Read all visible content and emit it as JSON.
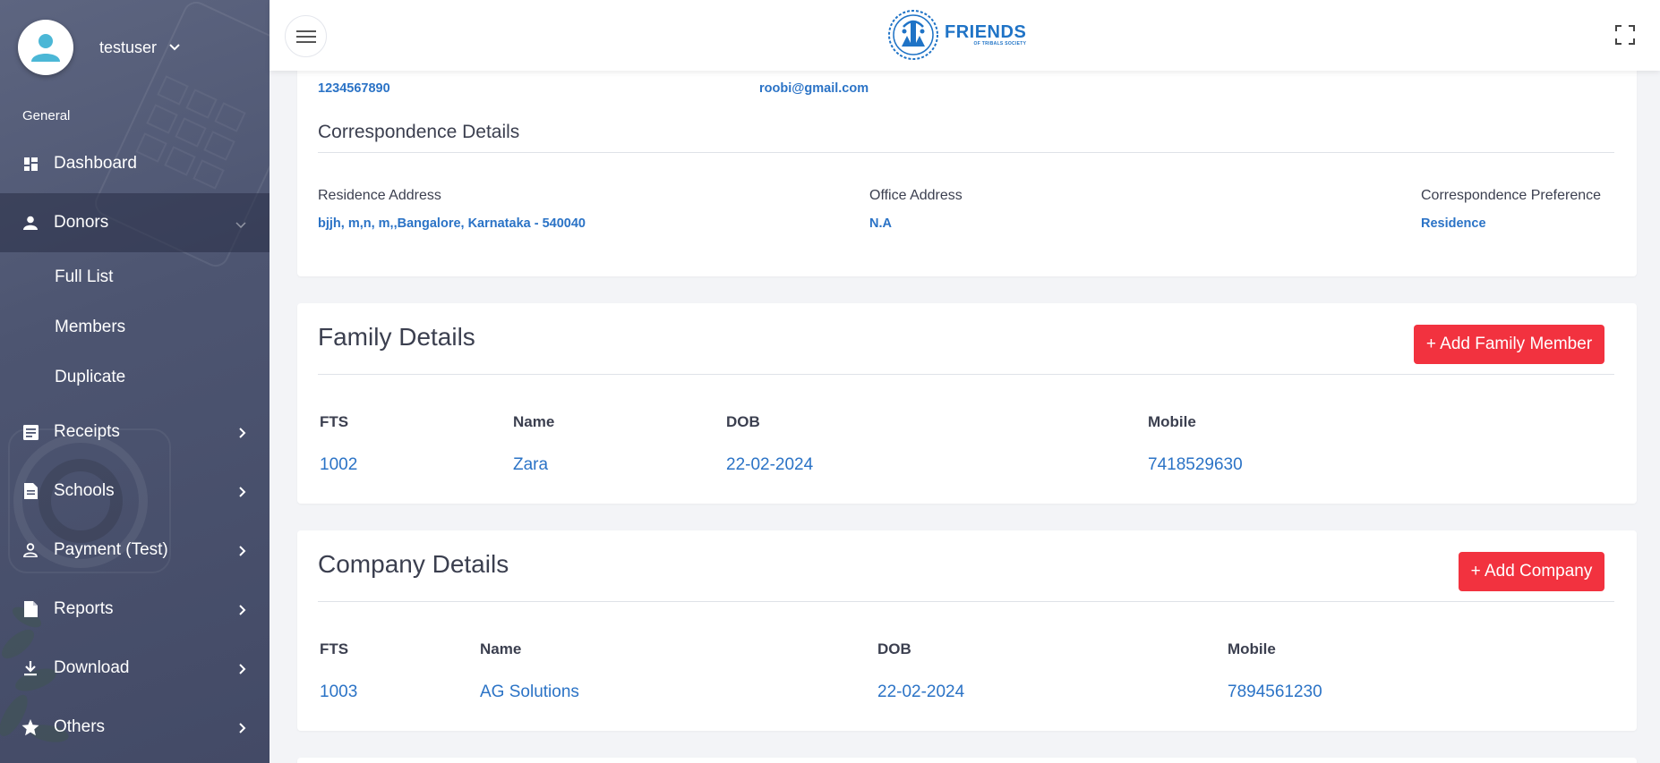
{
  "sidebar": {
    "username": "testuser",
    "section_label": "General",
    "items": [
      {
        "label": "Dashboard",
        "icon": "dashboard-icon"
      },
      {
        "label": "Donors",
        "icon": "person-icon"
      },
      {
        "label": "Receipts",
        "icon": "receipt-icon"
      },
      {
        "label": "Schools",
        "icon": "document-icon"
      },
      {
        "label": "Payment (Test)",
        "icon": "person-outline-icon"
      },
      {
        "label": "Reports",
        "icon": "file-icon"
      },
      {
        "label": "Download",
        "icon": "download-icon"
      },
      {
        "label": "Others",
        "icon": "star-icon"
      }
    ],
    "donor_subitems": [
      "Full List",
      "Members",
      "Duplicate"
    ]
  },
  "header": {
    "logo_main": "FRIENDS",
    "logo_sub": "OF TRIBALS SOCIETY"
  },
  "contact": {
    "mobile": "1234567890",
    "email": "roobi@gmail.com"
  },
  "correspondence": {
    "heading": "Correspondence Details",
    "residence_label": "Residence Address",
    "residence_value": "bjjh, m,n, m,,Bangalore, Karnataka - 540040",
    "office_label": "Office Address",
    "office_value": "N.A",
    "preference_label": "Correspondence Preference",
    "preference_value": "Residence"
  },
  "family": {
    "title": "Family Details",
    "add_button": "+ Add Family Member",
    "columns": [
      "FTS",
      "Name",
      "DOB",
      "Mobile"
    ],
    "rows": [
      {
        "fts": "1002",
        "name": "Zara",
        "dob": "22-02-2024",
        "mobile": "7418529630"
      }
    ]
  },
  "company": {
    "title": "Company Details",
    "add_button": "+ Add Company",
    "columns": [
      "FTS",
      "Name",
      "DOB",
      "Mobile"
    ],
    "rows": [
      {
        "fts": "1003",
        "name": "AG Solutions",
        "dob": "22-02-2024",
        "mobile": "7894561230"
      }
    ]
  },
  "colors": {
    "sidebar_bg": "#4d5571",
    "link": "#2b73c6",
    "button_red": "#f2323f",
    "logo_blue": "#1f73c6"
  }
}
